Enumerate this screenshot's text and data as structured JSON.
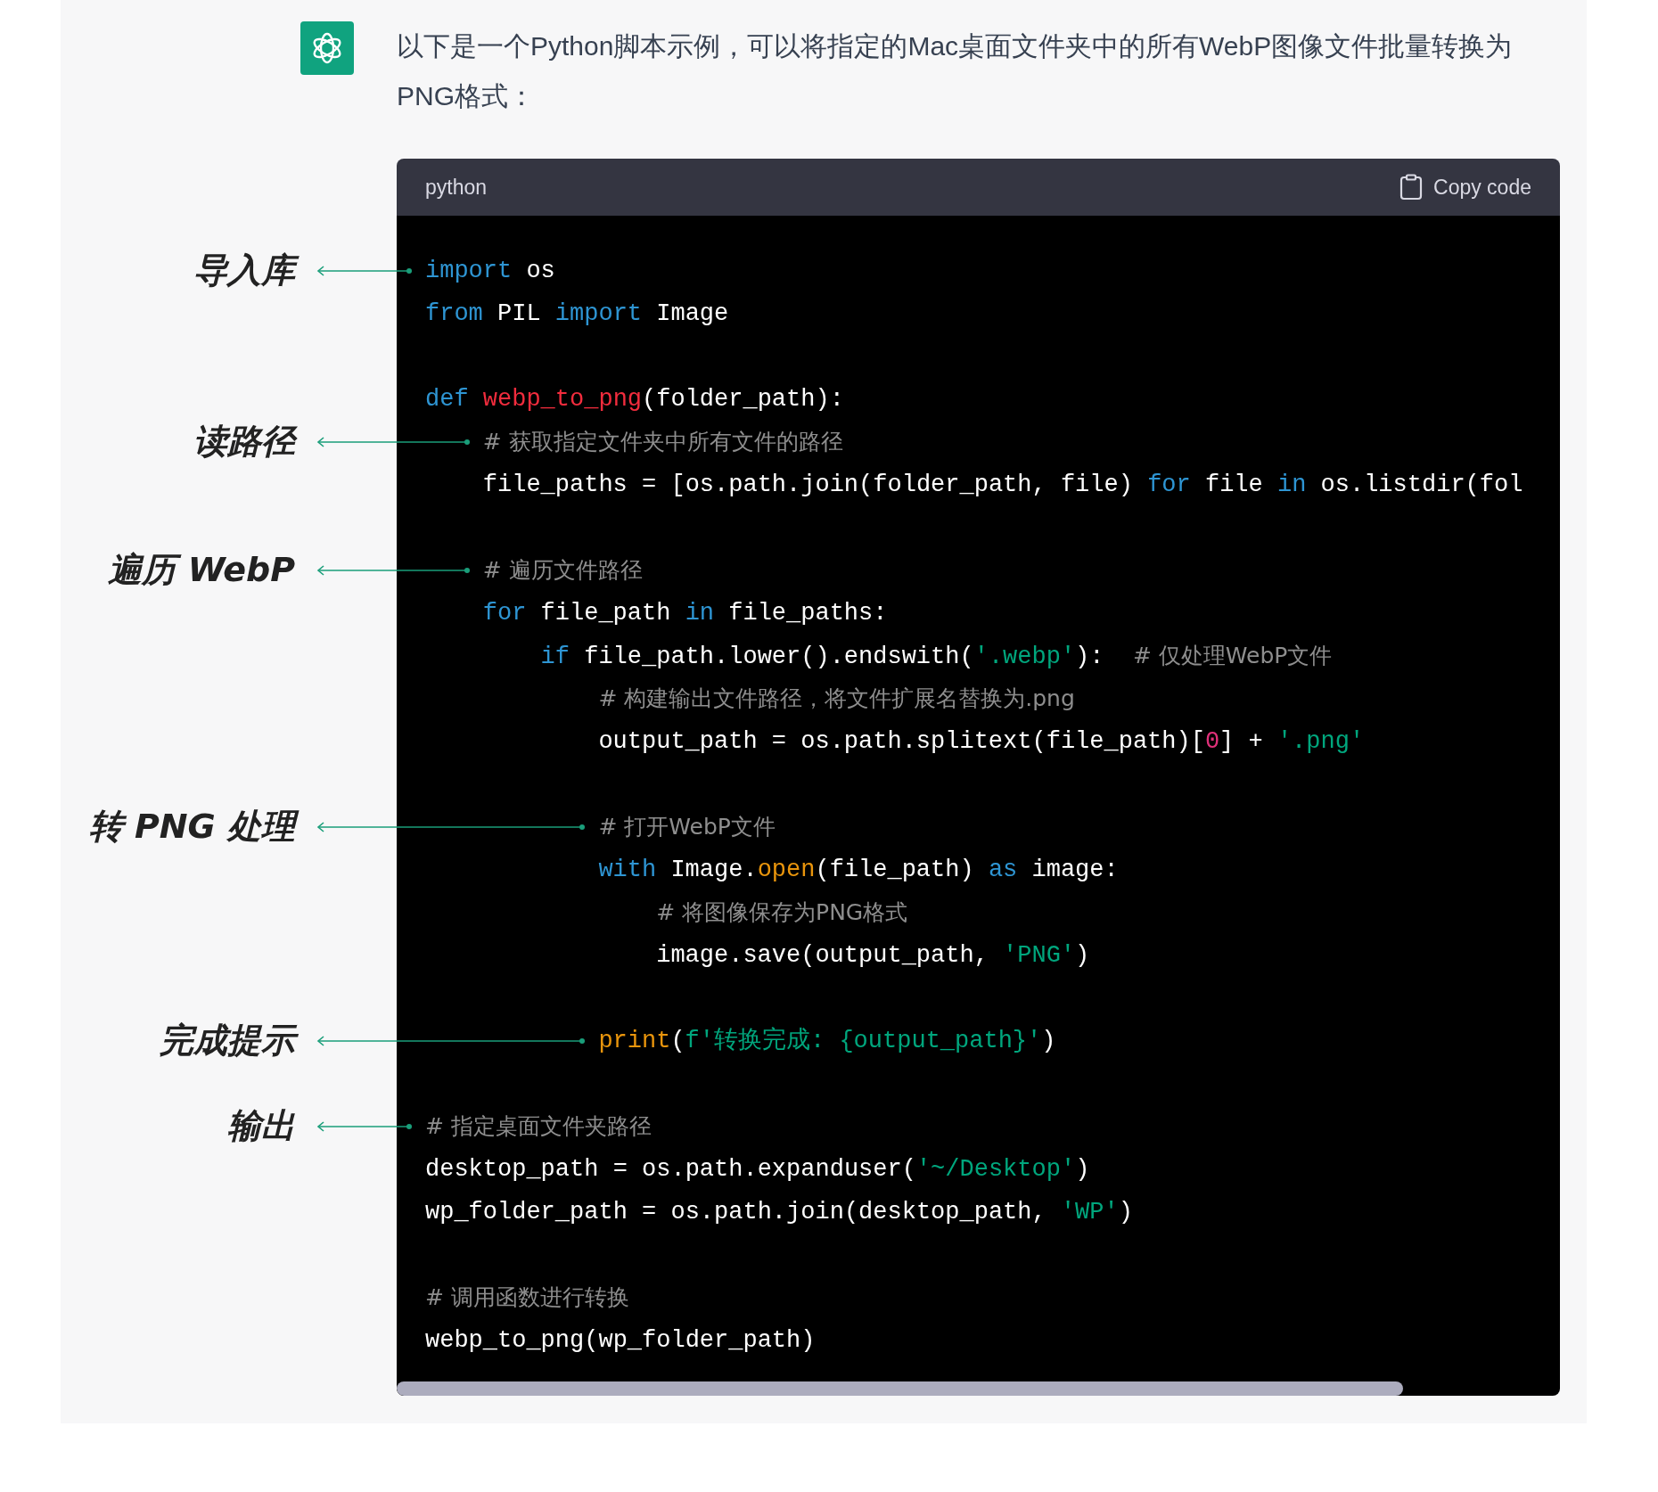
{
  "message": {
    "text": "以下是一个Python脚本示例，可以将指定的Mac桌面文件夹中的所有WebP图像文件批量转换为PNG格式："
  },
  "code_block": {
    "language": "python",
    "copy_button": "Copy code",
    "lines": [
      {
        "kind": "code",
        "annotation": "导入库",
        "tokens": [
          {
            "kind": "kw",
            "text": "import"
          },
          {
            "kind": "plain",
            "text": " os"
          }
        ]
      },
      {
        "kind": "code",
        "tokens": [
          {
            "kind": "kw",
            "text": "from"
          },
          {
            "kind": "plain",
            "text": " PIL "
          },
          {
            "kind": "kw",
            "text": "import"
          },
          {
            "kind": "plain",
            "text": " Image"
          }
        ]
      },
      {
        "kind": "blank"
      },
      {
        "kind": "code",
        "tokens": [
          {
            "kind": "kw",
            "text": "def "
          },
          {
            "kind": "func",
            "text": "webp_to_png"
          },
          {
            "kind": "plain",
            "text": "(folder_path):"
          }
        ],
        "children": [
          {
            "kind": "code",
            "annotation": "读路径",
            "tokens": [
              {
                "kind": "comment",
                "text": "# 获取指定文件夹中所有文件的路径"
              }
            ]
          },
          {
            "kind": "code",
            "tokens": [
              {
                "kind": "plain",
                "text": "file_paths = [os.path.join(folder_path, file) "
              },
              {
                "kind": "kw",
                "text": "for"
              },
              {
                "kind": "plain",
                "text": " file "
              },
              {
                "kind": "kw",
                "text": "in"
              },
              {
                "kind": "plain",
                "text": " os.listdir(fol"
              }
            ]
          },
          {
            "kind": "blank"
          },
          {
            "kind": "code",
            "annotation": "遍历 WebP",
            "tokens": [
              {
                "kind": "comment",
                "text": "# 遍历文件路径"
              }
            ]
          },
          {
            "kind": "code",
            "tokens": [
              {
                "kind": "kw",
                "text": "for"
              },
              {
                "kind": "plain",
                "text": " file_path "
              },
              {
                "kind": "kw",
                "text": "in"
              },
              {
                "kind": "plain",
                "text": " file_paths:"
              }
            ],
            "children": [
              {
                "kind": "code",
                "tokens": [
                  {
                    "kind": "kw",
                    "text": "if"
                  },
                  {
                    "kind": "plain",
                    "text": " file_path.lower().endswith("
                  },
                  {
                    "kind": "string",
                    "text": "'.webp'"
                  },
                  {
                    "kind": "plain",
                    "text": "):  "
                  },
                  {
                    "kind": "comment",
                    "text": "# 仅处理WebP文件"
                  }
                ],
                "children": [
                  {
                    "kind": "code",
                    "tokens": [
                      {
                        "kind": "comment",
                        "text": "# 构建输出文件路径，将文件扩展名替换为.png"
                      }
                    ]
                  },
                  {
                    "kind": "code",
                    "tokens": [
                      {
                        "kind": "plain",
                        "text": "output_path = os.path.splitext(file_path)["
                      },
                      {
                        "kind": "number",
                        "text": "0"
                      },
                      {
                        "kind": "plain",
                        "text": "] + "
                      },
                      {
                        "kind": "string",
                        "text": "'.png'"
                      }
                    ]
                  },
                  {
                    "kind": "blank"
                  },
                  {
                    "kind": "code",
                    "annotation": "转 PNG 处理",
                    "tokens": [
                      {
                        "kind": "comment",
                        "text": "# 打开WebP文件"
                      }
                    ]
                  },
                  {
                    "kind": "code",
                    "tokens": [
                      {
                        "kind": "kw",
                        "text": "with"
                      },
                      {
                        "kind": "plain",
                        "text": " Image."
                      },
                      {
                        "kind": "builtin",
                        "text": "open"
                      },
                      {
                        "kind": "plain",
                        "text": "(file_path) "
                      },
                      {
                        "kind": "kw",
                        "text": "as"
                      },
                      {
                        "kind": "plain",
                        "text": " image:"
                      }
                    ],
                    "children": [
                      {
                        "kind": "code",
                        "tokens": [
                          {
                            "kind": "comment",
                            "text": "# 将图像保存为PNG格式"
                          }
                        ]
                      },
                      {
                        "kind": "code",
                        "tokens": [
                          {
                            "kind": "plain",
                            "text": "image.save(output_path, "
                          },
                          {
                            "kind": "string",
                            "text": "'PNG'"
                          },
                          {
                            "kind": "plain",
                            "text": ")"
                          }
                        ]
                      }
                    ]
                  },
                  {
                    "kind": "blank"
                  },
                  {
                    "kind": "code",
                    "annotation": "完成提示",
                    "tokens": [
                      {
                        "kind": "builtin",
                        "text": "print"
                      },
                      {
                        "kind": "plain",
                        "text": "("
                      },
                      {
                        "kind": "string",
                        "text": "f'转换完成: {output_path}'"
                      },
                      {
                        "kind": "plain",
                        "text": ")"
                      }
                    ]
                  }
                ]
              }
            ]
          }
        ]
      },
      {
        "kind": "blank"
      },
      {
        "kind": "code",
        "annotation": "输出",
        "tokens": [
          {
            "kind": "comment",
            "text": "# 指定桌面文件夹路径"
          }
        ]
      },
      {
        "kind": "code",
        "tokens": [
          {
            "kind": "plain",
            "text": "desktop_path = os.path.expanduser("
          },
          {
            "kind": "string",
            "text": "'~/Desktop'"
          },
          {
            "kind": "plain",
            "text": ")"
          }
        ]
      },
      {
        "kind": "code",
        "tokens": [
          {
            "kind": "plain",
            "text": "wp_folder_path = os.path.join(desktop_path, "
          },
          {
            "kind": "string",
            "text": "'WP'"
          },
          {
            "kind": "plain",
            "text": ")"
          }
        ]
      },
      {
        "kind": "blank"
      },
      {
        "kind": "code",
        "tokens": [
          {
            "kind": "comment",
            "text": "# 调用函数进行转换"
          }
        ]
      },
      {
        "kind": "code",
        "tokens": [
          {
            "kind": "plain",
            "text": "webp_to_png(wp_folder_path)"
          }
        ]
      }
    ]
  }
}
